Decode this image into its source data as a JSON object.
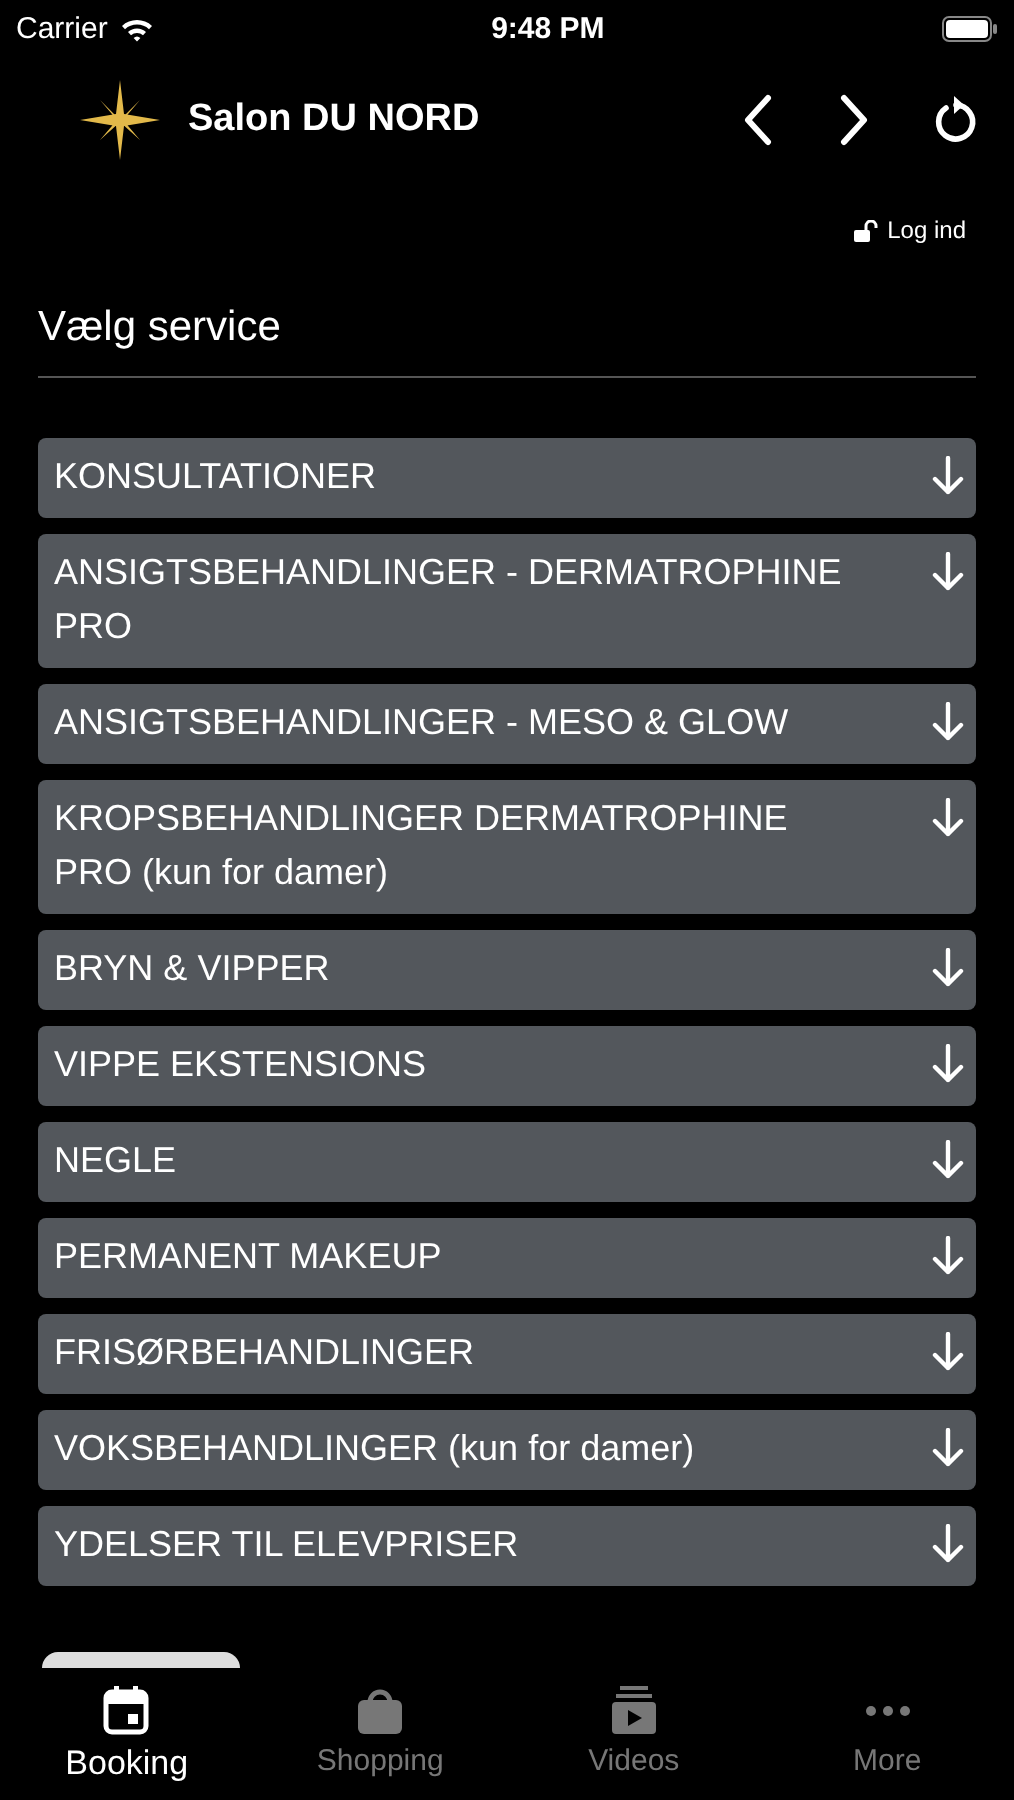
{
  "status_bar": {
    "carrier": "Carrier",
    "time": "9:48 PM"
  },
  "header": {
    "title": "Salon DU NORD"
  },
  "login": {
    "label": "Log ind"
  },
  "section": {
    "title": "Vælg service"
  },
  "services": [
    {
      "label": "KONSULTATIONER",
      "expanded": false
    },
    {
      "label": "ANSIGTSBEHANDLINGER - DERMATROPHINE PRO",
      "expanded": false
    },
    {
      "label": "ANSIGTSBEHANDLINGER - MESO & GLOW",
      "expanded": false
    },
    {
      "label": "KROPSBEHANDLINGER DERMATROPHINE PRO (kun for damer)",
      "expanded": false
    },
    {
      "label": "BRYN & VIPPER",
      "expanded": false
    },
    {
      "label": "VIPPE EKSTENSIONS",
      "expanded": false
    },
    {
      "label": "NEGLE",
      "expanded": false
    },
    {
      "label": "PERMANENT MAKEUP",
      "expanded": false
    },
    {
      "label": "FRISØRBEHANDLINGER",
      "expanded": false
    },
    {
      "label": "VOKSBEHANDLINGER (kun for damer)",
      "expanded": false
    },
    {
      "label": "YDELSER TIL ELEVPRISER",
      "expanded": false
    }
  ],
  "tab_bar": [
    {
      "kind": "booking",
      "label": "Booking",
      "selected": true
    },
    {
      "kind": "shopping",
      "label": "Shopping",
      "selected": false
    },
    {
      "kind": "videos",
      "label": "Videos",
      "selected": false
    },
    {
      "kind": "more",
      "label": "More",
      "selected": false
    }
  ]
}
